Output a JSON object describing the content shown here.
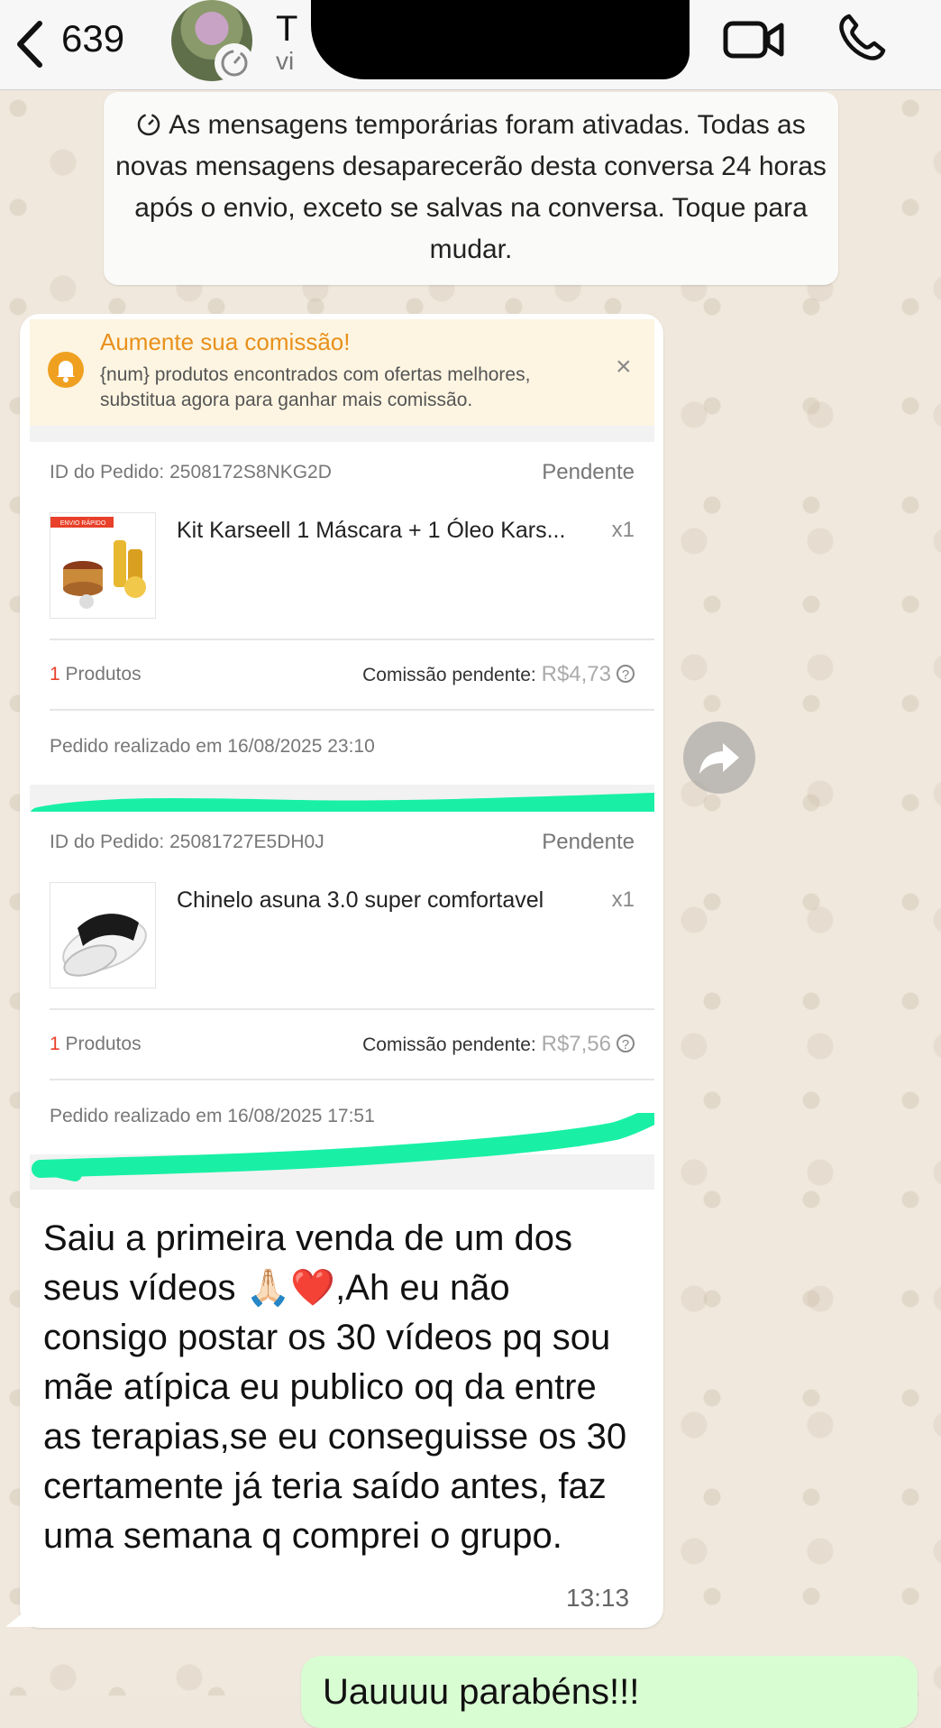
{
  "header": {
    "back_count": "639",
    "contact_name": "T",
    "contact_subtitle": "vi"
  },
  "system_notice": {
    "text": "As mensagens temporárias foram ativadas. Todas as novas mensagens desaparecerão desta conversa 24 horas após o envio, exceto se salvas na conversa. Toque para mudar."
  },
  "screenshot": {
    "banner": {
      "title": "Aumente sua comissão!",
      "text": "{num} produtos encontrados com ofertas melhores, substitua agora para ganhar mais comissão.",
      "close": "×"
    },
    "orders": [
      {
        "order_id": "ID do Pedido: 2508172S8NKG2D",
        "status": "Pendente",
        "product_name": "Kit Karseell 1 Máscara + 1 Óleo Kars...",
        "qty": "x1",
        "count_num": "1",
        "count_label": " Produtos",
        "commission_label": "Comissão pendente: ",
        "commission_amount": "R$4,73",
        "date": "Pedido realizado em 16/08/2025 23:10",
        "thumb_badge": "ENVIO RÁPIDO"
      },
      {
        "order_id": "ID do Pedido: 25081727E5DH0J",
        "status": "Pendente",
        "product_name": "Chinelo asuna 3.0 super comfortavel",
        "qty": "x1",
        "count_num": "1",
        "count_label": " Produtos",
        "commission_label": "Comissão pendente: ",
        "commission_amount": "R$7,56",
        "date": "Pedido realizado em 16/08/2025 17:51"
      }
    ]
  },
  "incoming_message": {
    "text": "Saiu a primeira venda de um dos seus vídeos 🙏🏻❤️,Ah eu não consigo postar os 30 vídeos pq sou mãe atípica eu publico oq da entre as terapias,se eu conseguisse os 30 certamente  já teria saído antes, faz uma semana q comprei  o grupo.",
    "time": "13:13"
  },
  "outgoing_message": {
    "text": "Uauuuu parabéns!!!"
  },
  "colors": {
    "scribble": "#19f0a6",
    "banner_accent": "#e8901a",
    "outgoing_bubble": "#d9fdd3"
  }
}
